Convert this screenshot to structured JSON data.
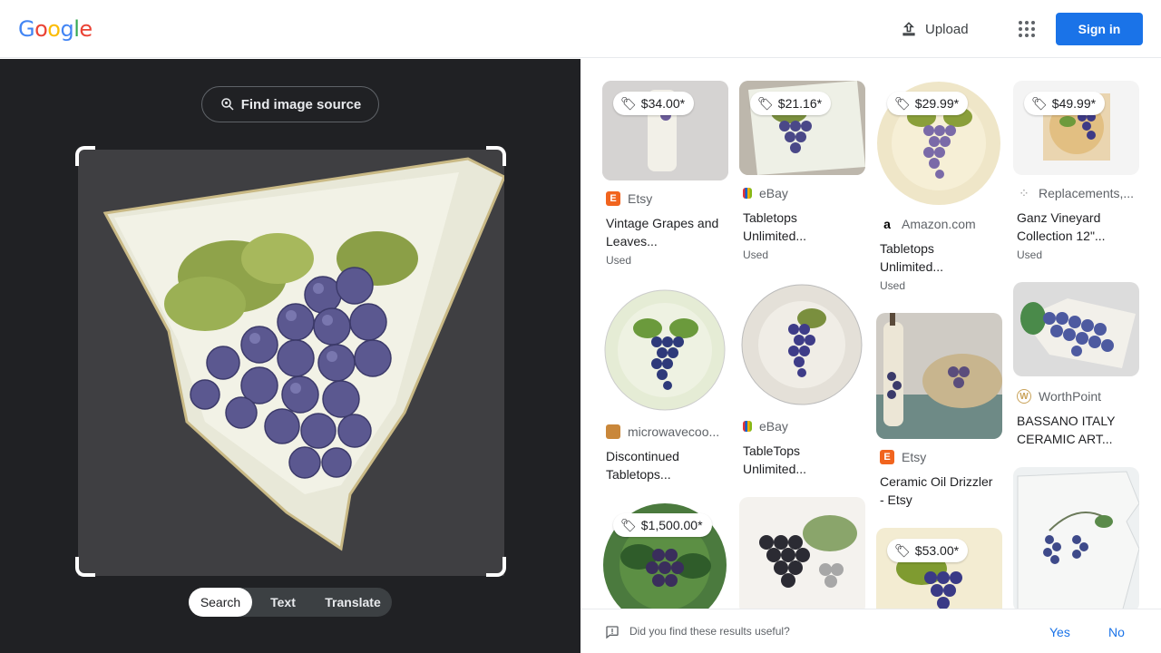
{
  "header": {
    "logo_letters": [
      "G",
      "o",
      "o",
      "g",
      "l",
      "e"
    ],
    "logo_colors": [
      "#4285F4",
      "#EA4335",
      "#FBBC05",
      "#4285F4",
      "#34A853",
      "#EA4335"
    ],
    "upload_label": "Upload",
    "signin_label": "Sign in"
  },
  "lens": {
    "find_source_label": "Find image source",
    "modes": [
      "Search",
      "Text",
      "Translate"
    ],
    "active_mode": "Search"
  },
  "results": [
    {
      "price": "$34.00*",
      "source": "Etsy",
      "title": "Vintage Grapes and Leaves...",
      "tag": "Used",
      "favicon": "etsy-icon"
    },
    {
      "price": "$21.16*",
      "source": "eBay",
      "title": "Tabletops Unlimited...",
      "tag": "Used",
      "favicon": "ebay-icon"
    },
    {
      "price": "$29.99*",
      "source": "Amazon.com",
      "title": "Tabletops Unlimited...",
      "tag": "Used",
      "favicon": "amazon-icon"
    },
    {
      "price": "$49.99*",
      "source": "Replacements,...",
      "title": "Ganz Vineyard Collection 12\"...",
      "tag": "Used",
      "favicon": "replacements-icon"
    },
    {
      "source": "microwavecoo...",
      "title": "Discontinued Tabletops...",
      "favicon": "microwave-site-icon"
    },
    {
      "source": "eBay",
      "title": "TableTops Unlimited...",
      "favicon": "ebay-icon"
    },
    {
      "source": "Etsy",
      "title": "Ceramic Oil Drizzler - Etsy",
      "favicon": "etsy-icon"
    },
    {
      "source": "WorthPoint",
      "title": "BASSANO ITALY CERAMIC ART...",
      "favicon": "worthpoint-icon"
    },
    {
      "price": "$1,500.00*"
    },
    {
      "price": "$53.00*"
    }
  ],
  "feedback": {
    "question": "Did you find these results useful?",
    "yes": "Yes",
    "no": "No"
  }
}
